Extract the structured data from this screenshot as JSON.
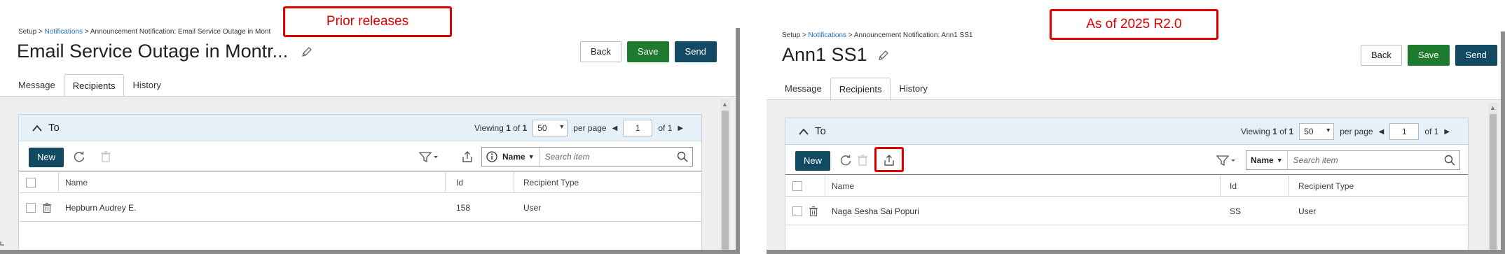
{
  "left": {
    "badge": "Prior releases",
    "breadcrumb": {
      "root": "Setup",
      "sep1": " > ",
      "link": "Notifications",
      "sep2": " > ",
      "rest": "Announcement Notification: Email Service Outage in Mont"
    },
    "title": "Email Service Outage in Montr...",
    "buttons": {
      "back": "Back",
      "save": "Save",
      "send": "Send"
    },
    "tabs": [
      "Message",
      "Recipients",
      "History"
    ],
    "card_title": "To",
    "pager": {
      "viewing": "Viewing",
      "current": "1",
      "of_word": "of",
      "total": "1",
      "per_page_value": "50",
      "per_page_label": "per page",
      "page_input": "1",
      "of_pages": "of 1"
    },
    "toolbar": {
      "new_label": "New"
    },
    "search": {
      "field": "Name",
      "placeholder": "Search item"
    },
    "columns": [
      "Name",
      "Id",
      "Recipient Type"
    ],
    "rows": [
      {
        "name": "Hepburn Audrey E.",
        "id": "158",
        "type": "User"
      }
    ]
  },
  "right": {
    "badge": "As of 2025 R2.0",
    "breadcrumb": {
      "root": "Setup",
      "sep1": " > ",
      "link": "Notifications",
      "sep2": " > ",
      "rest": "Announcement Notification: Ann1 SS1"
    },
    "title": "Ann1 SS1",
    "buttons": {
      "back": "Back",
      "save": "Save",
      "send": "Send"
    },
    "tabs": [
      "Message",
      "Recipients",
      "History"
    ],
    "card_title": "To",
    "pager": {
      "viewing": "Viewing",
      "current": "1",
      "of_word": "of",
      "total": "1",
      "per_page_value": "50",
      "per_page_label": "per page",
      "page_input": "1",
      "of_pages": "of 1"
    },
    "toolbar": {
      "new_label": "New"
    },
    "search": {
      "field": "Name",
      "placeholder": "Search item"
    },
    "columns": [
      "Name",
      "Id",
      "Recipient Type"
    ],
    "rows": [
      {
        "name": "Naga Sesha Sai Popuri",
        "id": "SS",
        "type": "User"
      }
    ]
  },
  "colors": {
    "highlight": "#e00000",
    "save": "#1d7a2e",
    "send": "#124a63",
    "link": "#1f6fbf",
    "card_header": "#e5f0f8"
  },
  "icons": [
    "pencil-icon",
    "chevron-up-icon",
    "refresh-icon",
    "trash-icon",
    "filter-icon",
    "export-icon",
    "info-icon",
    "search-icon",
    "triangle-left-icon",
    "triangle-right-icon"
  ]
}
